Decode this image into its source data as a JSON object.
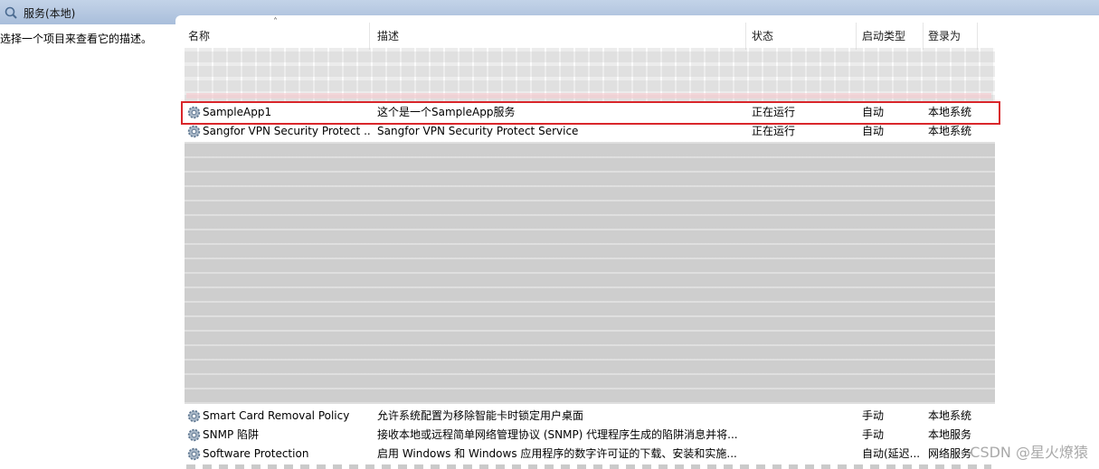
{
  "window": {
    "title": "服务(本地)",
    "description_hint": "选择一个项目来查看它的描述。"
  },
  "columns": {
    "name": "名称",
    "description": "描述",
    "status": "状态",
    "startup_type": "启动类型",
    "log_on_as": "登录为"
  },
  "rows_top": [
    {
      "name": "SampleApp1",
      "description": "这个是一个SampleApp服务",
      "status": "正在运行",
      "startup": "自动",
      "logon": "本地系统"
    },
    {
      "name": "Sangfor VPN Security Protect ...",
      "description": "Sangfor VPN Security Protect Service",
      "status": "正在运行",
      "startup": "自动",
      "logon": "本地系统"
    }
  ],
  "rows_bottom": [
    {
      "name": "Smart Card Removal Policy",
      "description": "允许系统配置为移除智能卡时锁定用户桌面",
      "status": "",
      "startup": "手动",
      "logon": "本地系统"
    },
    {
      "name": "SNMP 陷阱",
      "description": "接收本地或远程简单网络管理协议 (SNMP) 代理程序生成的陷阱消息并将...",
      "status": "",
      "startup": "手动",
      "logon": "本地服务"
    },
    {
      "name": "Software Protection",
      "description": "启用 Windows 和 Windows 应用程序的数字许可证的下载、安装和实施...",
      "status": "",
      "startup": "自动(延迟...",
      "logon": "网络服务"
    }
  ],
  "watermark": "CSDN @星火燎猿",
  "colors": {
    "highlight_border": "#d9262b",
    "title_bar": "#b5c8e0"
  }
}
